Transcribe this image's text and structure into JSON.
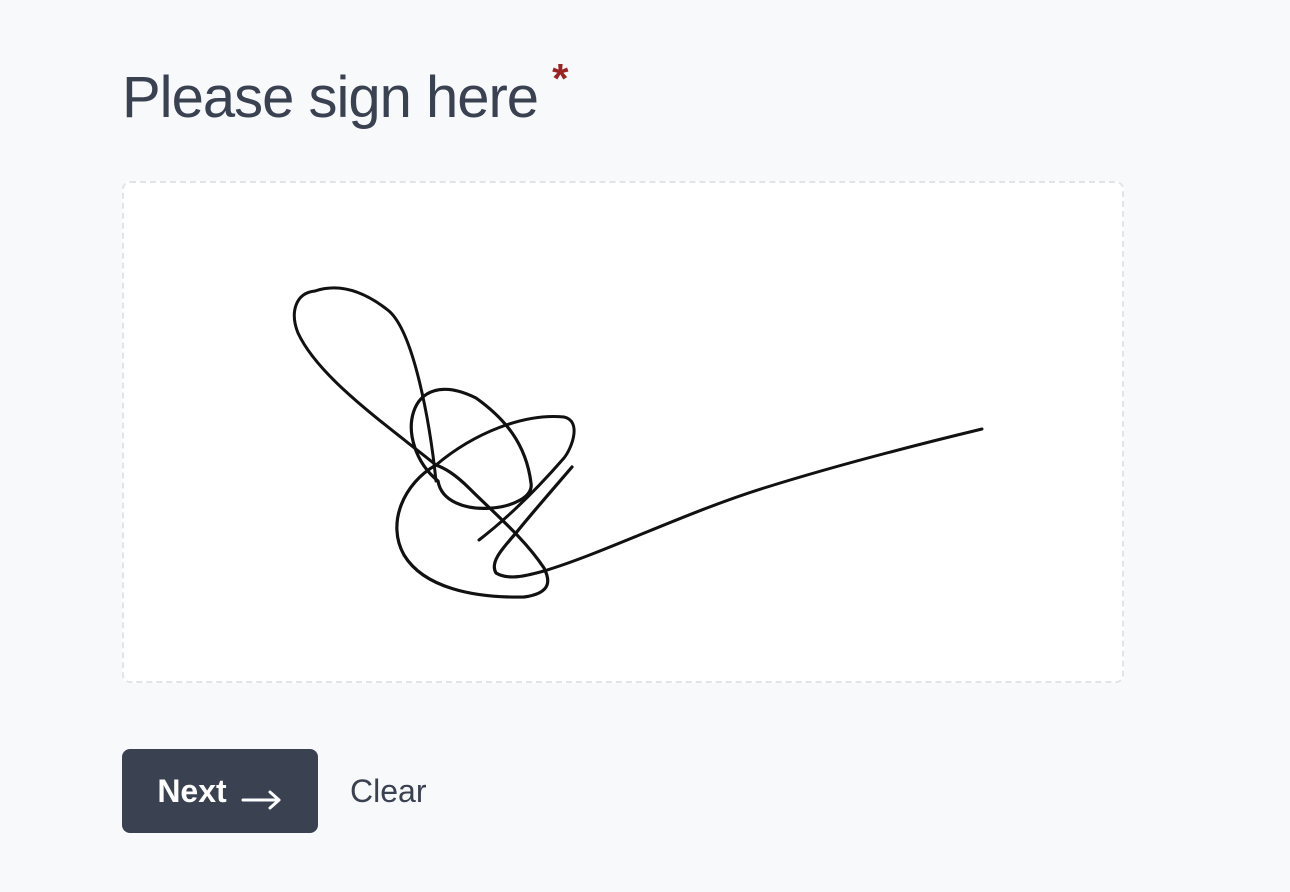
{
  "question": {
    "title": "Please sign here",
    "required_mark": "*"
  },
  "signature_pad": {
    "has_signature": true,
    "stroke_color": "#111111"
  },
  "actions": {
    "next_label": "Next",
    "next_icon": "arrow-right-icon",
    "clear_label": "Clear"
  },
  "colors": {
    "background": "#f8f9fb",
    "text": "#3a4252",
    "primary_button": "#3a4252",
    "required": "#9b2323"
  }
}
